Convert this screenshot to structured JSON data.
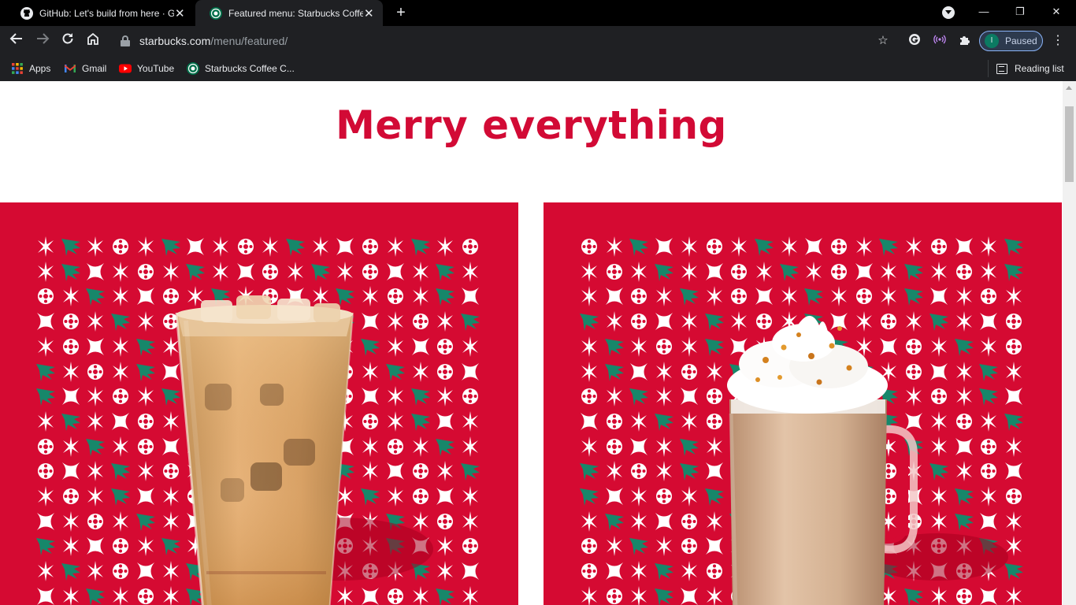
{
  "browser": {
    "tabs": [
      {
        "title": "GitHub: Let's build from here · GitHub",
        "favicon": "github-icon",
        "active": false
      },
      {
        "title": "Featured menu: Starbucks Coffee Company",
        "favicon": "starbucks-icon",
        "active": true
      }
    ],
    "window_controls": {
      "minimize": "—",
      "restore": "❐",
      "close": "✕"
    },
    "address": {
      "domain": "starbucks.com",
      "path": "/menu/featured/"
    },
    "profile": {
      "initial": "I",
      "status": "Paused"
    },
    "bookmarks": [
      {
        "label": "Apps",
        "icon": "apps-grid-icon"
      },
      {
        "label": "Gmail",
        "icon": "gmail-icon"
      },
      {
        "label": "YouTube",
        "icon": "youtube-icon"
      },
      {
        "label": "Starbucks Coffee C...",
        "icon": "starbucks-icon"
      }
    ],
    "reading_list": "Reading list"
  },
  "page": {
    "headline": "Merry everything",
    "colors": {
      "brand_red": "#d20a35",
      "card_red": "#d50a32",
      "tree_green": "#17876a"
    },
    "cards": [
      {
        "name": "iced-drink-card",
        "image": "iced-latte-glass"
      },
      {
        "name": "hot-drink-card",
        "image": "whipped-cream-mug"
      }
    ]
  }
}
